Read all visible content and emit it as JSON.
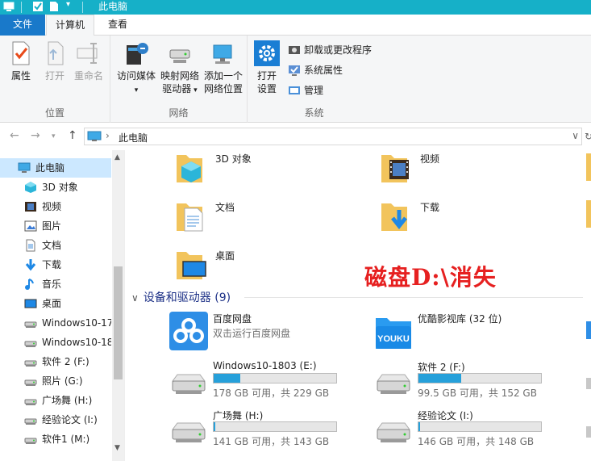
{
  "window": {
    "title": "此电脑"
  },
  "tabs": {
    "file": "文件",
    "computer": "计算机",
    "view": "查看"
  },
  "ribbon": {
    "location": {
      "label": "位置",
      "properties": "属性",
      "open": "打开",
      "rename": "重命名"
    },
    "network": {
      "label": "网络",
      "access_media": "访问媒体",
      "map_drive_1": "映射网络",
      "map_drive_2": "驱动器",
      "add_location_1": "添加一个",
      "add_location_2": "网络位置"
    },
    "system": {
      "label": "系统",
      "open_settings_1": "打开",
      "open_settings_2": "设置",
      "uninstall": "卸载或更改程序",
      "sys_props": "系统属性",
      "manage": "管理"
    }
  },
  "address": {
    "crumb": "此电脑",
    "separator": "›"
  },
  "nav": {
    "items": [
      {
        "label": "此电脑",
        "icon": "pc-icon",
        "selected": true
      },
      {
        "label": "3D 对象",
        "icon": "cube-icon"
      },
      {
        "label": "视频",
        "icon": "video-icon"
      },
      {
        "label": "图片",
        "icon": "picture-icon"
      },
      {
        "label": "文档",
        "icon": "document-icon"
      },
      {
        "label": "下载",
        "icon": "download-icon"
      },
      {
        "label": "音乐",
        "icon": "music-icon"
      },
      {
        "label": "桌面",
        "icon": "desktop-icon"
      },
      {
        "label": "Windows10-17",
        "icon": "drive-icon"
      },
      {
        "label": "Windows10-18",
        "icon": "drive-icon"
      },
      {
        "label": "软件 2 (F:)",
        "icon": "drive-icon"
      },
      {
        "label": "照片 (G:)",
        "icon": "drive-icon"
      },
      {
        "label": "广场舞 (H:)",
        "icon": "drive-icon"
      },
      {
        "label": "经验论文 (I:)",
        "icon": "drive-icon"
      },
      {
        "label": "软件1 (M:)",
        "icon": "drive-icon"
      }
    ]
  },
  "folders": [
    {
      "name": "3D 对象",
      "icon": "3d-objects-folder-icon"
    },
    {
      "name": "视频",
      "icon": "videos-folder-icon"
    },
    {
      "name": "文档",
      "icon": "documents-folder-icon"
    },
    {
      "name": "下载",
      "icon": "downloads-folder-icon"
    },
    {
      "name": "桌面",
      "icon": "desktop-folder-icon"
    }
  ],
  "devices_section": {
    "label": "设备和驱动器 (9)"
  },
  "apps": [
    {
      "name": "百度网盘",
      "sub": "双击运行百度网盘",
      "icon": "baidu-cloud-icon"
    },
    {
      "name": "优酷影视库 (32 位)",
      "sub": "",
      "icon": "youku-icon"
    }
  ],
  "drives": [
    {
      "name": "Windows10-1803 (E:)",
      "info": "178 GB 可用，共 229 GB",
      "used_fraction": 0.22
    },
    {
      "name": "软件 2 (F:)",
      "info": "99.5 GB 可用，共 152 GB",
      "used_fraction": 0.35
    },
    {
      "name": "广场舞 (H:)",
      "info": "141 GB 可用，共 143 GB",
      "used_fraction": 0.014
    },
    {
      "name": "经验论文 (I:)",
      "info": "146 GB 可用，共 148 GB",
      "used_fraction": 0.014
    }
  ],
  "overlay": {
    "text": "磁盘D:\\消失"
  },
  "colors": {
    "accent": "#16b0c8",
    "file_tab": "#1979ca",
    "bar_fill": "#26a0da",
    "overlay": "#e62020"
  }
}
